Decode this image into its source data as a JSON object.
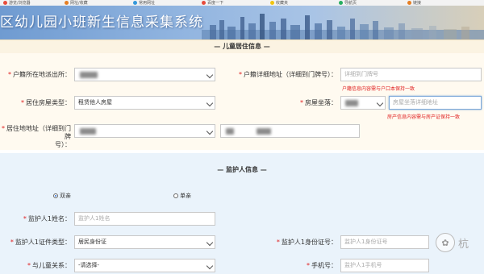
{
  "window": {
    "title": "区幼儿园小班新生信息采集系统"
  },
  "colors": {
    "required": "#e02020",
    "section_bg": "#fbf3e2",
    "guardian_bg": "#eaf3fb",
    "banner_blue": "#6f9bd1"
  },
  "bookmarks": [
    {
      "label": "游览/浏览器",
      "icon": "#e74c3c"
    },
    {
      "label": "网址/收藏",
      "icon": "#e67e22"
    },
    {
      "label": "常用网址",
      "icon": "#3498db"
    },
    {
      "label": "百度一下",
      "icon": "#e74c3c"
    },
    {
      "label": "收藏夹",
      "icon": "#f1c40f"
    },
    {
      "label": "导航页",
      "icon": "#27ae60"
    },
    {
      "label": "链接",
      "icon": "#e67e22"
    }
  ],
  "section_child": {
    "title": "— 儿童居住信息 —"
  },
  "child_fields": {
    "household_police_label": "户籍所在地派出所：",
    "household_address_label": "户籍详细地址（详细到门牌号）：",
    "household_address_placeholder": "详细到门牌号",
    "household_address_error": "户籍信息内容需与户口本保持一致",
    "residence_type_label": "居住房屋类型：",
    "residence_type_value": "租赁他人房屋",
    "property_location_label": "房屋坐落：",
    "property_location_placeholder": "房屋坐落详细地址",
    "property_location_error": "房产信息内容需与房产证保持一致",
    "residence_address_label": "居住地地址（详细到门牌号）：",
    "residence_address_label_line1": "居住地地址（详细到门牌",
    "residence_address_label_line2": "号）："
  },
  "section_guardian": {
    "title": "— 监护人信息 —"
  },
  "guardian_fields": {
    "radio_both": "双亲",
    "radio_single": "单亲",
    "guardian1_name_label": "监护人1姓名：",
    "guardian1_name_placeholder": "监护人1姓名",
    "guardian1_id_type_label": "监护人1证件类型：",
    "guardian1_id_type_value": "居民身份证",
    "guardian1_id_number_label": "监护人1身份证号：",
    "guardian1_id_number_placeholder": "监护人1身份证号",
    "relation_label": "与儿童关系：",
    "relation_value": "-请选择-",
    "phone_label": "手机号：",
    "phone_placeholder": "监护人1手机号"
  },
  "watermark": {
    "text": "杭"
  }
}
